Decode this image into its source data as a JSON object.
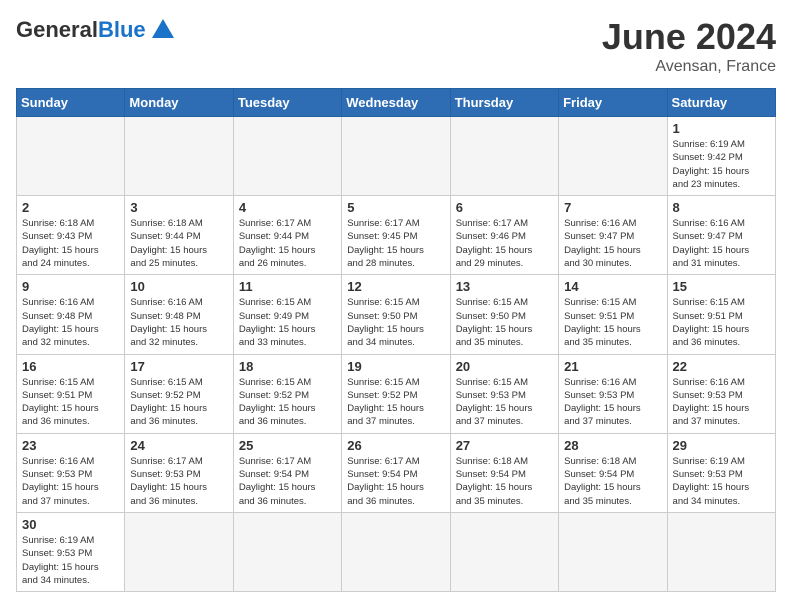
{
  "header": {
    "logo_general": "General",
    "logo_blue": "Blue",
    "title": "June 2024",
    "subtitle": "Avensan, France"
  },
  "weekdays": [
    "Sunday",
    "Monday",
    "Tuesday",
    "Wednesday",
    "Thursday",
    "Friday",
    "Saturday"
  ],
  "days": [
    {
      "date": "",
      "empty": true
    },
    {
      "date": "",
      "empty": true
    },
    {
      "date": "",
      "empty": true
    },
    {
      "date": "",
      "empty": true
    },
    {
      "date": "",
      "empty": true
    },
    {
      "date": "",
      "empty": true
    },
    {
      "num": "1",
      "info": "Sunrise: 6:19 AM\nSunset: 9:42 PM\nDaylight: 15 hours\nand 23 minutes."
    },
    {
      "num": "2",
      "info": "Sunrise: 6:18 AM\nSunset: 9:43 PM\nDaylight: 15 hours\nand 24 minutes."
    },
    {
      "num": "3",
      "info": "Sunrise: 6:18 AM\nSunset: 9:44 PM\nDaylight: 15 hours\nand 25 minutes."
    },
    {
      "num": "4",
      "info": "Sunrise: 6:17 AM\nSunset: 9:44 PM\nDaylight: 15 hours\nand 26 minutes."
    },
    {
      "num": "5",
      "info": "Sunrise: 6:17 AM\nSunset: 9:45 PM\nDaylight: 15 hours\nand 28 minutes."
    },
    {
      "num": "6",
      "info": "Sunrise: 6:17 AM\nSunset: 9:46 PM\nDaylight: 15 hours\nand 29 minutes."
    },
    {
      "num": "7",
      "info": "Sunrise: 6:16 AM\nSunset: 9:47 PM\nDaylight: 15 hours\nand 30 minutes."
    },
    {
      "num": "8",
      "info": "Sunrise: 6:16 AM\nSunset: 9:47 PM\nDaylight: 15 hours\nand 31 minutes."
    },
    {
      "num": "9",
      "info": "Sunrise: 6:16 AM\nSunset: 9:48 PM\nDaylight: 15 hours\nand 32 minutes."
    },
    {
      "num": "10",
      "info": "Sunrise: 6:16 AM\nSunset: 9:48 PM\nDaylight: 15 hours\nand 32 minutes."
    },
    {
      "num": "11",
      "info": "Sunrise: 6:15 AM\nSunset: 9:49 PM\nDaylight: 15 hours\nand 33 minutes."
    },
    {
      "num": "12",
      "info": "Sunrise: 6:15 AM\nSunset: 9:50 PM\nDaylight: 15 hours\nand 34 minutes."
    },
    {
      "num": "13",
      "info": "Sunrise: 6:15 AM\nSunset: 9:50 PM\nDaylight: 15 hours\nand 35 minutes."
    },
    {
      "num": "14",
      "info": "Sunrise: 6:15 AM\nSunset: 9:51 PM\nDaylight: 15 hours\nand 35 minutes."
    },
    {
      "num": "15",
      "info": "Sunrise: 6:15 AM\nSunset: 9:51 PM\nDaylight: 15 hours\nand 36 minutes."
    },
    {
      "num": "16",
      "info": "Sunrise: 6:15 AM\nSunset: 9:51 PM\nDaylight: 15 hours\nand 36 minutes."
    },
    {
      "num": "17",
      "info": "Sunrise: 6:15 AM\nSunset: 9:52 PM\nDaylight: 15 hours\nand 36 minutes."
    },
    {
      "num": "18",
      "info": "Sunrise: 6:15 AM\nSunset: 9:52 PM\nDaylight: 15 hours\nand 36 minutes."
    },
    {
      "num": "19",
      "info": "Sunrise: 6:15 AM\nSunset: 9:52 PM\nDaylight: 15 hours\nand 37 minutes."
    },
    {
      "num": "20",
      "info": "Sunrise: 6:15 AM\nSunset: 9:53 PM\nDaylight: 15 hours\nand 37 minutes."
    },
    {
      "num": "21",
      "info": "Sunrise: 6:16 AM\nSunset: 9:53 PM\nDaylight: 15 hours\nand 37 minutes."
    },
    {
      "num": "22",
      "info": "Sunrise: 6:16 AM\nSunset: 9:53 PM\nDaylight: 15 hours\nand 37 minutes."
    },
    {
      "num": "23",
      "info": "Sunrise: 6:16 AM\nSunset: 9:53 PM\nDaylight: 15 hours\nand 37 minutes."
    },
    {
      "num": "24",
      "info": "Sunrise: 6:17 AM\nSunset: 9:53 PM\nDaylight: 15 hours\nand 36 minutes."
    },
    {
      "num": "25",
      "info": "Sunrise: 6:17 AM\nSunset: 9:54 PM\nDaylight: 15 hours\nand 36 minutes."
    },
    {
      "num": "26",
      "info": "Sunrise: 6:17 AM\nSunset: 9:54 PM\nDaylight: 15 hours\nand 36 minutes."
    },
    {
      "num": "27",
      "info": "Sunrise: 6:18 AM\nSunset: 9:54 PM\nDaylight: 15 hours\nand 35 minutes."
    },
    {
      "num": "28",
      "info": "Sunrise: 6:18 AM\nSunset: 9:54 PM\nDaylight: 15 hours\nand 35 minutes."
    },
    {
      "num": "29",
      "info": "Sunrise: 6:19 AM\nSunset: 9:53 PM\nDaylight: 15 hours\nand 34 minutes."
    },
    {
      "num": "30",
      "info": "Sunrise: 6:19 AM\nSunset: 9:53 PM\nDaylight: 15 hours\nand 34 minutes."
    },
    {
      "date": "",
      "empty": true
    },
    {
      "date": "",
      "empty": true
    },
    {
      "date": "",
      "empty": true
    },
    {
      "date": "",
      "empty": true
    },
    {
      "date": "",
      "empty": true
    },
    {
      "date": "",
      "empty": true
    }
  ]
}
